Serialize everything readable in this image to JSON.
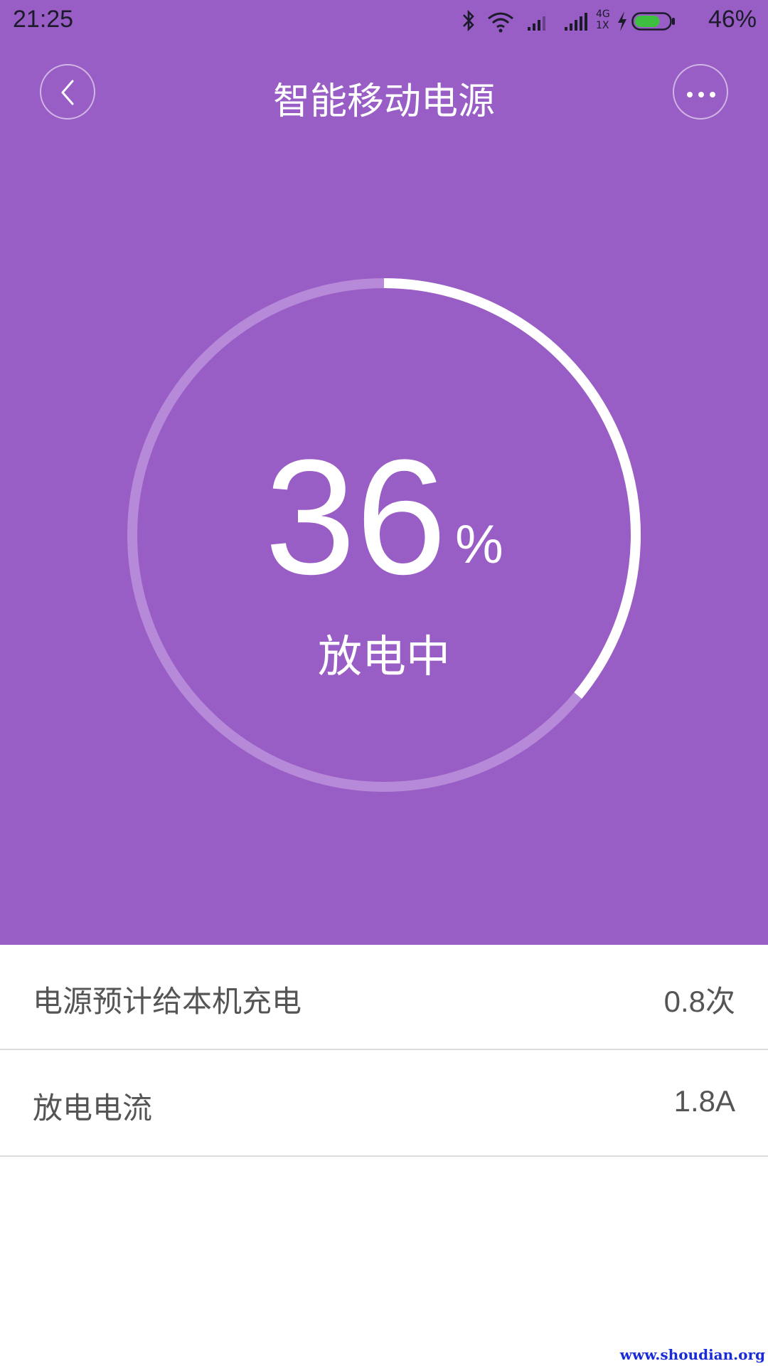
{
  "status_bar": {
    "time": "21:25",
    "network": "4G\n1X",
    "battery_percent": "46%",
    "battery_level": 0.46,
    "battery_color": "#3fbf3f"
  },
  "nav": {
    "title": "智能移动电源",
    "back_icon": "chevron-left-icon",
    "more_icon": "more-dots-icon"
  },
  "power": {
    "percent_value": "36",
    "percent_sign": "%",
    "status": "放电中",
    "level": 0.36,
    "ring_color": "#ffffff",
    "track_color": "#b68ad8",
    "background_color": "#995dc6"
  },
  "details": [
    {
      "label": "电源预计给本机充电",
      "value": "0.8次"
    },
    {
      "label": "放电电流",
      "value": "1.8A"
    }
  ],
  "watermark": "www.shoudian.org"
}
